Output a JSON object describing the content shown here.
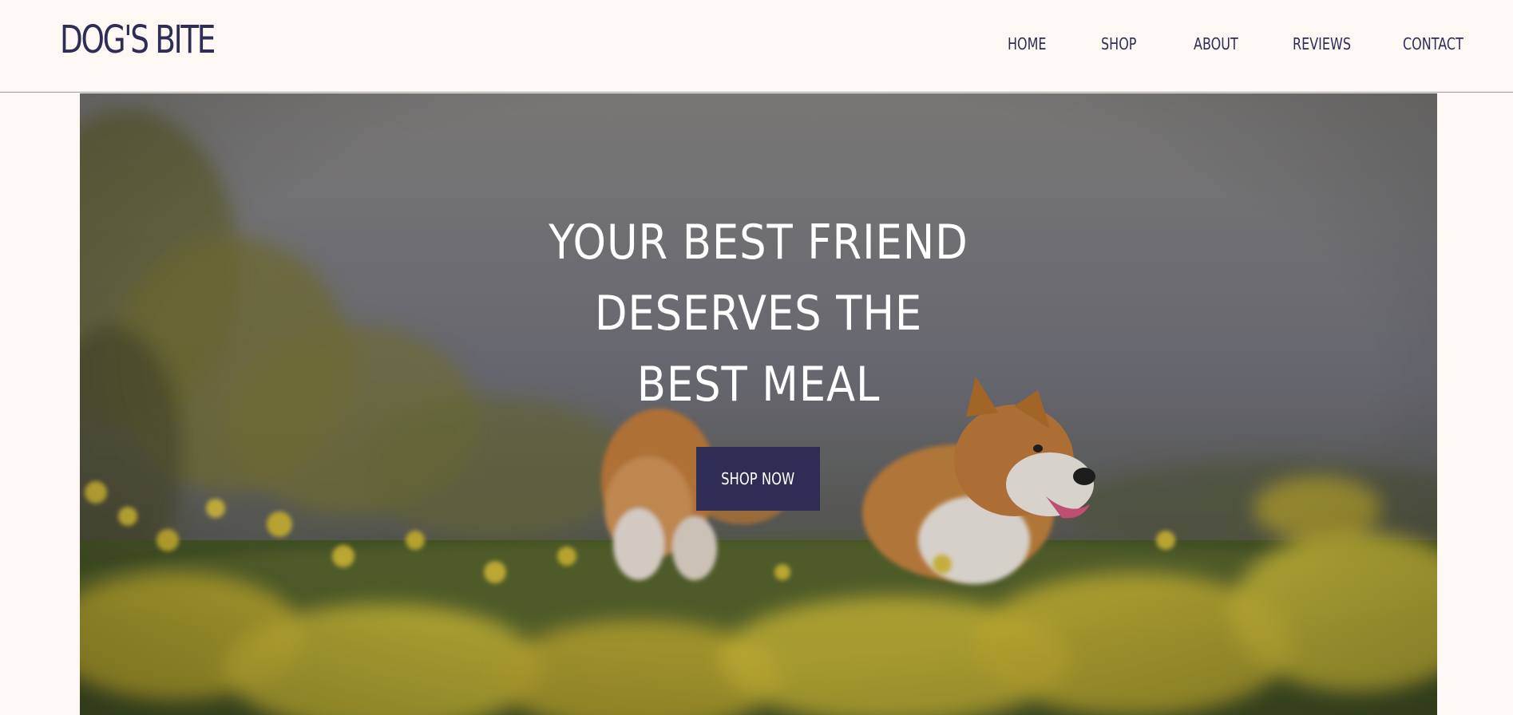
{
  "brand": {
    "logo_text": "DOG'S BITE"
  },
  "nav": {
    "items": [
      {
        "label": "HOME"
      },
      {
        "label": "SHOP"
      },
      {
        "label": "ABOUT"
      },
      {
        "label": "REVIEWS"
      },
      {
        "label": "CONTACT"
      }
    ]
  },
  "hero": {
    "title_lines": [
      "YOUR BEST FRIEND",
      "DESERVES THE",
      "BEST MEAL"
    ],
    "cta_label": "SHOP NOW",
    "image_subject": "two corgis in a field of yellow flowers"
  },
  "colors": {
    "background": "#fdf8f4",
    "brand_navy": "#2e2d55",
    "hero_text": "#ffffff"
  }
}
